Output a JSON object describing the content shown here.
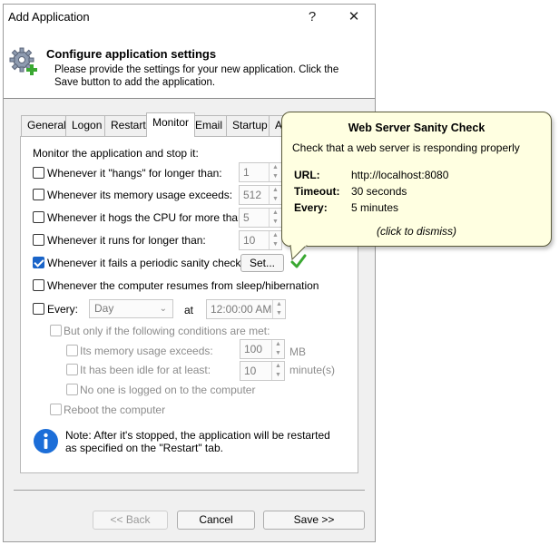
{
  "window": {
    "title": "Add Application",
    "help_label": "?",
    "close_label": "✕"
  },
  "header": {
    "title": "Configure application settings",
    "description": "Please provide the settings for your new application. Click the Save button to add the application."
  },
  "tabs": [
    {
      "label": "General"
    },
    {
      "label": "Logon"
    },
    {
      "label": "Restart"
    },
    {
      "label": "Monitor",
      "active": true
    },
    {
      "label": "Email"
    },
    {
      "label": "Startup"
    },
    {
      "label": "A"
    }
  ],
  "monitor": {
    "heading": "Monitor the application and stop it:",
    "hangs": {
      "label": "Whenever it \"hangs\" for longer than:",
      "checked": false,
      "value": "1"
    },
    "memory": {
      "label": "Whenever its memory usage exceeds:",
      "checked": false,
      "value": "512"
    },
    "cpu": {
      "label": "Whenever it hogs the CPU for more than:",
      "checked": false,
      "value": "5"
    },
    "runs": {
      "label": "Whenever it runs for longer than:",
      "checked": false,
      "value": "10"
    },
    "sanity": {
      "label": "Whenever it fails a periodic sanity check",
      "checked": true,
      "button": "Set..."
    },
    "resume": {
      "label": "Whenever the computer resumes from sleep/hibernation",
      "checked": false
    },
    "every": {
      "label": "Every:",
      "checked": false,
      "period": "Day",
      "at_label": "at",
      "time": "12:00:00 AM"
    },
    "conditions": {
      "label": "But only if the following conditions are met:",
      "memory_label": "Its memory usage exceeds:",
      "memory_value": "100",
      "memory_unit": "MB",
      "idle_label": "It has been idle for at least:",
      "idle_value": "10",
      "idle_unit": "minute(s)",
      "nobody_label": "No one is logged on to the computer"
    },
    "reboot_label": "Reboot the computer",
    "note": "Note: After it's stopped, the application will be restarted as specified on the \"Restart\" tab."
  },
  "footer": {
    "back": "<< Back",
    "cancel": "Cancel",
    "save": "Save >>"
  },
  "tooltip": {
    "title": "Web Server Sanity Check",
    "description": "Check that a web server is responding properly",
    "url_key": "URL:",
    "url_value": "http://localhost:8080",
    "timeout_key": "Timeout:",
    "timeout_value": "30 seconds",
    "every_key": "Every:",
    "every_value": "5 minutes",
    "dismiss": "(click to dismiss)"
  },
  "colors": {
    "accent": "#1a64c8",
    "tooltip_bg": "#ffffe1",
    "check_green": "#3aa832",
    "info_blue": "#1c6ed8"
  }
}
